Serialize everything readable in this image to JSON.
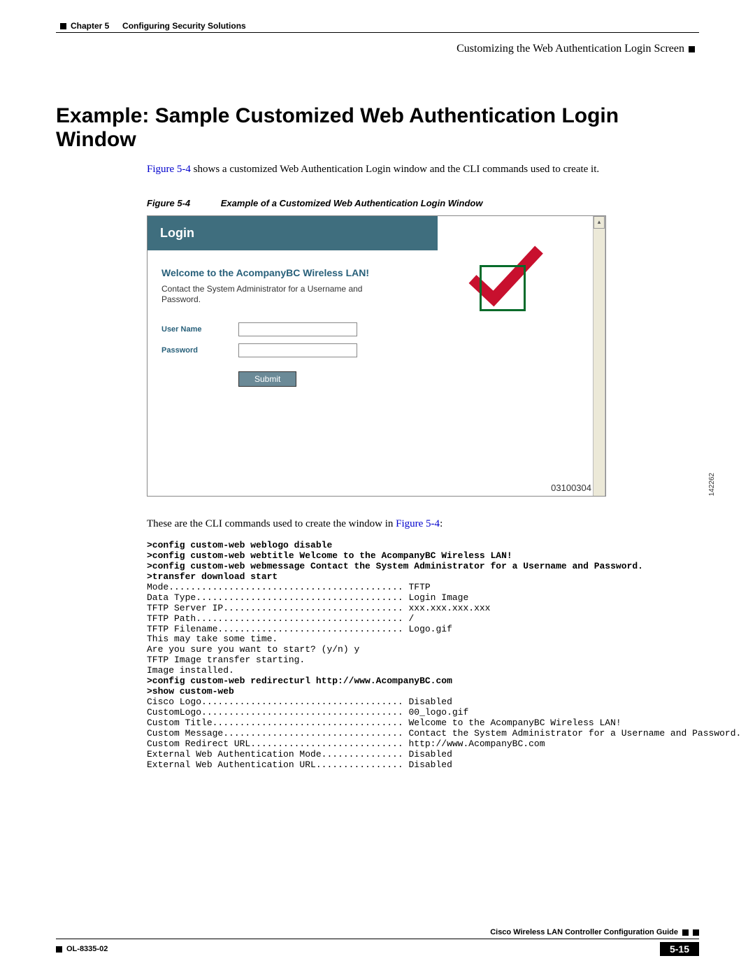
{
  "header": {
    "chapter_label": "Chapter 5",
    "chapter_title": "Configuring Security Solutions",
    "section_title": "Customizing the Web Authentication Login Screen"
  },
  "heading": "Example: Sample Customized Web Authentication Login Window",
  "intro": {
    "xref": "Figure 5-4",
    "rest": " shows a customized Web Authentication Login window and the CLI commands used to create it."
  },
  "figure": {
    "num": "Figure 5-4",
    "caption": "Example of a Customized Web Authentication Login Window",
    "timestamp": "03100304",
    "refnum": "142262",
    "login": {
      "title": "Login",
      "welcome": "Welcome to the AcompanyBC Wireless LAN!",
      "message": "Contact the System Administrator for a Username and Password.",
      "username_label": "User Name",
      "password_label": "Password",
      "submit": "Submit"
    }
  },
  "cli_intro": {
    "text": "These are the CLI commands used to create the window in ",
    "xref": "Figure 5-4",
    "tail": ":"
  },
  "cli": {
    "c1": ">config custom-web weblogo disable",
    "c2": ">config custom-web webtitle Welcome to the AcompanyBC Wireless LAN!",
    "c3": ">config custom-web webmessage Contact the System Administrator for a Username and Password.",
    "c4": ">transfer download start",
    "o1": "Mode........................................... TFTP",
    "o2": "Data Type...................................... Login Image",
    "o3": "TFTP Server IP................................. xxx.xxx.xxx.xxx",
    "o4": "TFTP Path...................................... /",
    "o5": "TFTP Filename.................................. Logo.gif",
    "o6": "This may take some time.",
    "o7": "Are you sure you want to start? (y/n) y",
    "o8": "TFTP Image transfer starting.",
    "o9": "Image installed.",
    "c5": ">config custom-web redirecturl http://www.AcompanyBC.com",
    "c6": ">show custom-web",
    "o10": "Cisco Logo..................................... Disabled",
    "o11": "CustomLogo..................................... 00_logo.gif",
    "o12": "Custom Title................................... Welcome to the AcompanyBC Wireless LAN!",
    "o13": "Custom Message................................. Contact the System Administrator for a Username and Password.",
    "o14": "Custom Redirect URL............................ http://www.AcompanyBC.com",
    "o15": "External Web Authentication Mode............... Disabled",
    "o16": "External Web Authentication URL................ Disabled"
  },
  "footer": {
    "guide_title": "Cisco Wireless LAN Controller Configuration Guide",
    "doc_number": "OL-8335-02",
    "page_num": "5-15"
  }
}
